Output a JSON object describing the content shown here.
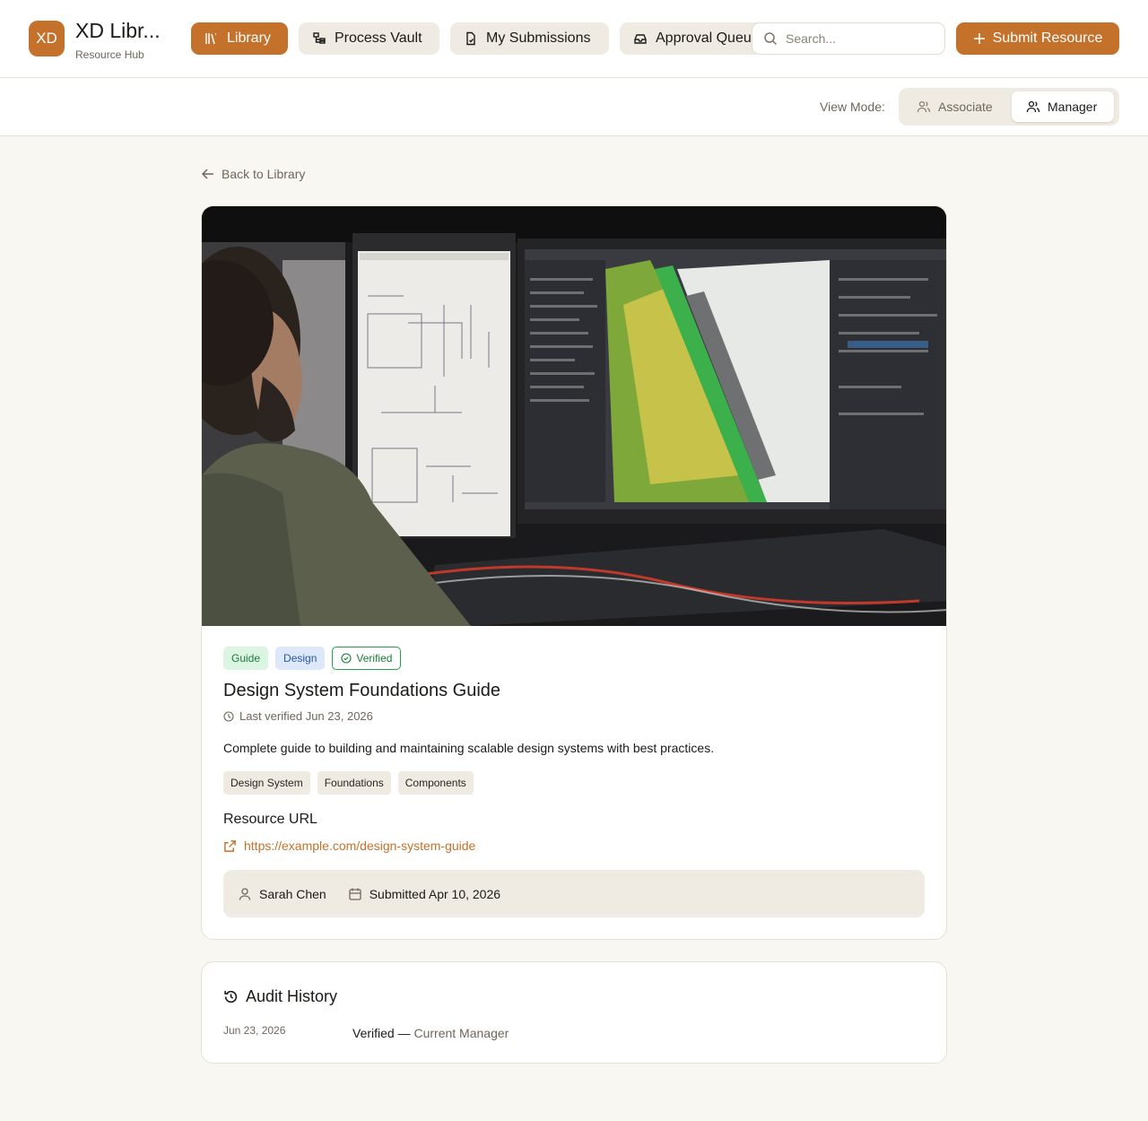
{
  "header": {
    "logo_text": "XD",
    "app_title": "XD Libr...",
    "app_subtitle": "Resource Hub",
    "nav": [
      {
        "label": "Library",
        "icon": "library-icon",
        "active": true
      },
      {
        "label": "Process Vault",
        "icon": "process-icon",
        "active": false
      },
      {
        "label": "My Submissions",
        "icon": "document-icon",
        "active": false
      },
      {
        "label": "Approval Queue",
        "icon": "inbox-icon",
        "active": false
      }
    ],
    "search_placeholder": "Search...",
    "submit_label": "Submit Resource"
  },
  "view_mode": {
    "label": "View Mode:",
    "options": [
      {
        "label": "Associate",
        "active": false
      },
      {
        "label": "Manager",
        "active": true
      }
    ]
  },
  "back_label": "Back to Library",
  "resource": {
    "badges": {
      "type": "Guide",
      "category": "Design",
      "status": "Verified"
    },
    "title": "Design System Foundations Guide",
    "last_verified": "Last verified Jun 23, 2026",
    "description": "Complete guide to building and maintaining scalable design systems with best practices.",
    "tags": [
      "Design System",
      "Foundations",
      "Components"
    ],
    "url_label": "Resource URL",
    "url": "https://example.com/design-system-guide",
    "author": "Sarah Chen",
    "submitted": "Submitted Apr 10, 2026"
  },
  "audit": {
    "title": "Audit History",
    "entries": [
      {
        "date": "Jun 23, 2026",
        "action": "Verified",
        "separator": " — ",
        "actor": "Current Manager"
      }
    ]
  },
  "colors": {
    "accent": "#c4712b",
    "background": "#f9f7f2",
    "verified_green": "#27a14b"
  }
}
